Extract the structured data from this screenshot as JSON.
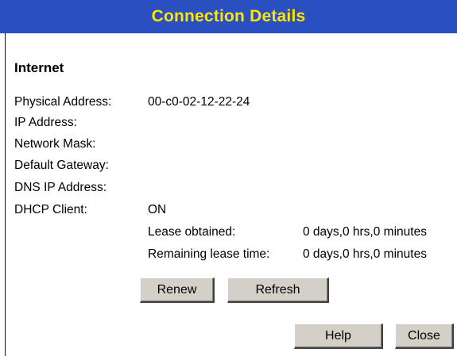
{
  "header": {
    "title": "Connection Details"
  },
  "section": {
    "heading": "Internet"
  },
  "fields": [
    {
      "label": "Physical Address:",
      "value": "00-c0-02-12-22-24"
    },
    {
      "label": "IP Address:",
      "value": ""
    },
    {
      "label": "Network Mask:",
      "value": ""
    },
    {
      "label": "Default Gateway:",
      "value": ""
    },
    {
      "label": "DNS IP Address:",
      "value": ""
    },
    {
      "label": "DHCP Client:",
      "value": "ON"
    }
  ],
  "lease": {
    "obtained_label": "Lease obtained:",
    "obtained_value": "0 days,0 hrs,0 minutes",
    "remaining_label": "Remaining lease time:",
    "remaining_value": "0 days,0 hrs,0 minutes"
  },
  "buttons": {
    "renew": "Renew",
    "refresh": "Refresh",
    "help": "Help",
    "close": "Close"
  },
  "colors": {
    "header_bg": "#2a4fc0",
    "header_text": "#ffe600",
    "button_face": "#d4d0c8"
  }
}
